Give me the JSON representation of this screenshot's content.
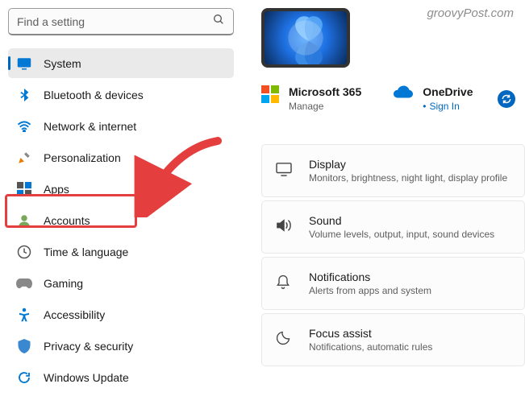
{
  "watermark": "groovyPost.com",
  "search": {
    "placeholder": "Find a setting"
  },
  "sidebar": {
    "items": [
      {
        "label": "System",
        "selected": true
      },
      {
        "label": "Bluetooth & devices"
      },
      {
        "label": "Network & internet"
      },
      {
        "label": "Personalization"
      },
      {
        "label": "Apps",
        "highlighted": true
      },
      {
        "label": "Accounts"
      },
      {
        "label": "Time & language"
      },
      {
        "label": "Gaming"
      },
      {
        "label": "Accessibility"
      },
      {
        "label": "Privacy & security"
      },
      {
        "label": "Windows Update"
      }
    ]
  },
  "accounts": {
    "microsoft365": {
      "title": "Microsoft 365",
      "subtitle": "Manage"
    },
    "onedrive": {
      "title": "OneDrive",
      "subtitle": "Sign In"
    }
  },
  "cards": [
    {
      "title": "Display",
      "subtitle": "Monitors, brightness, night light, display profile"
    },
    {
      "title": "Sound",
      "subtitle": "Volume levels, output, input, sound devices"
    },
    {
      "title": "Notifications",
      "subtitle": "Alerts from apps and system"
    },
    {
      "title": "Focus assist",
      "subtitle": "Notifications, automatic rules"
    }
  ]
}
